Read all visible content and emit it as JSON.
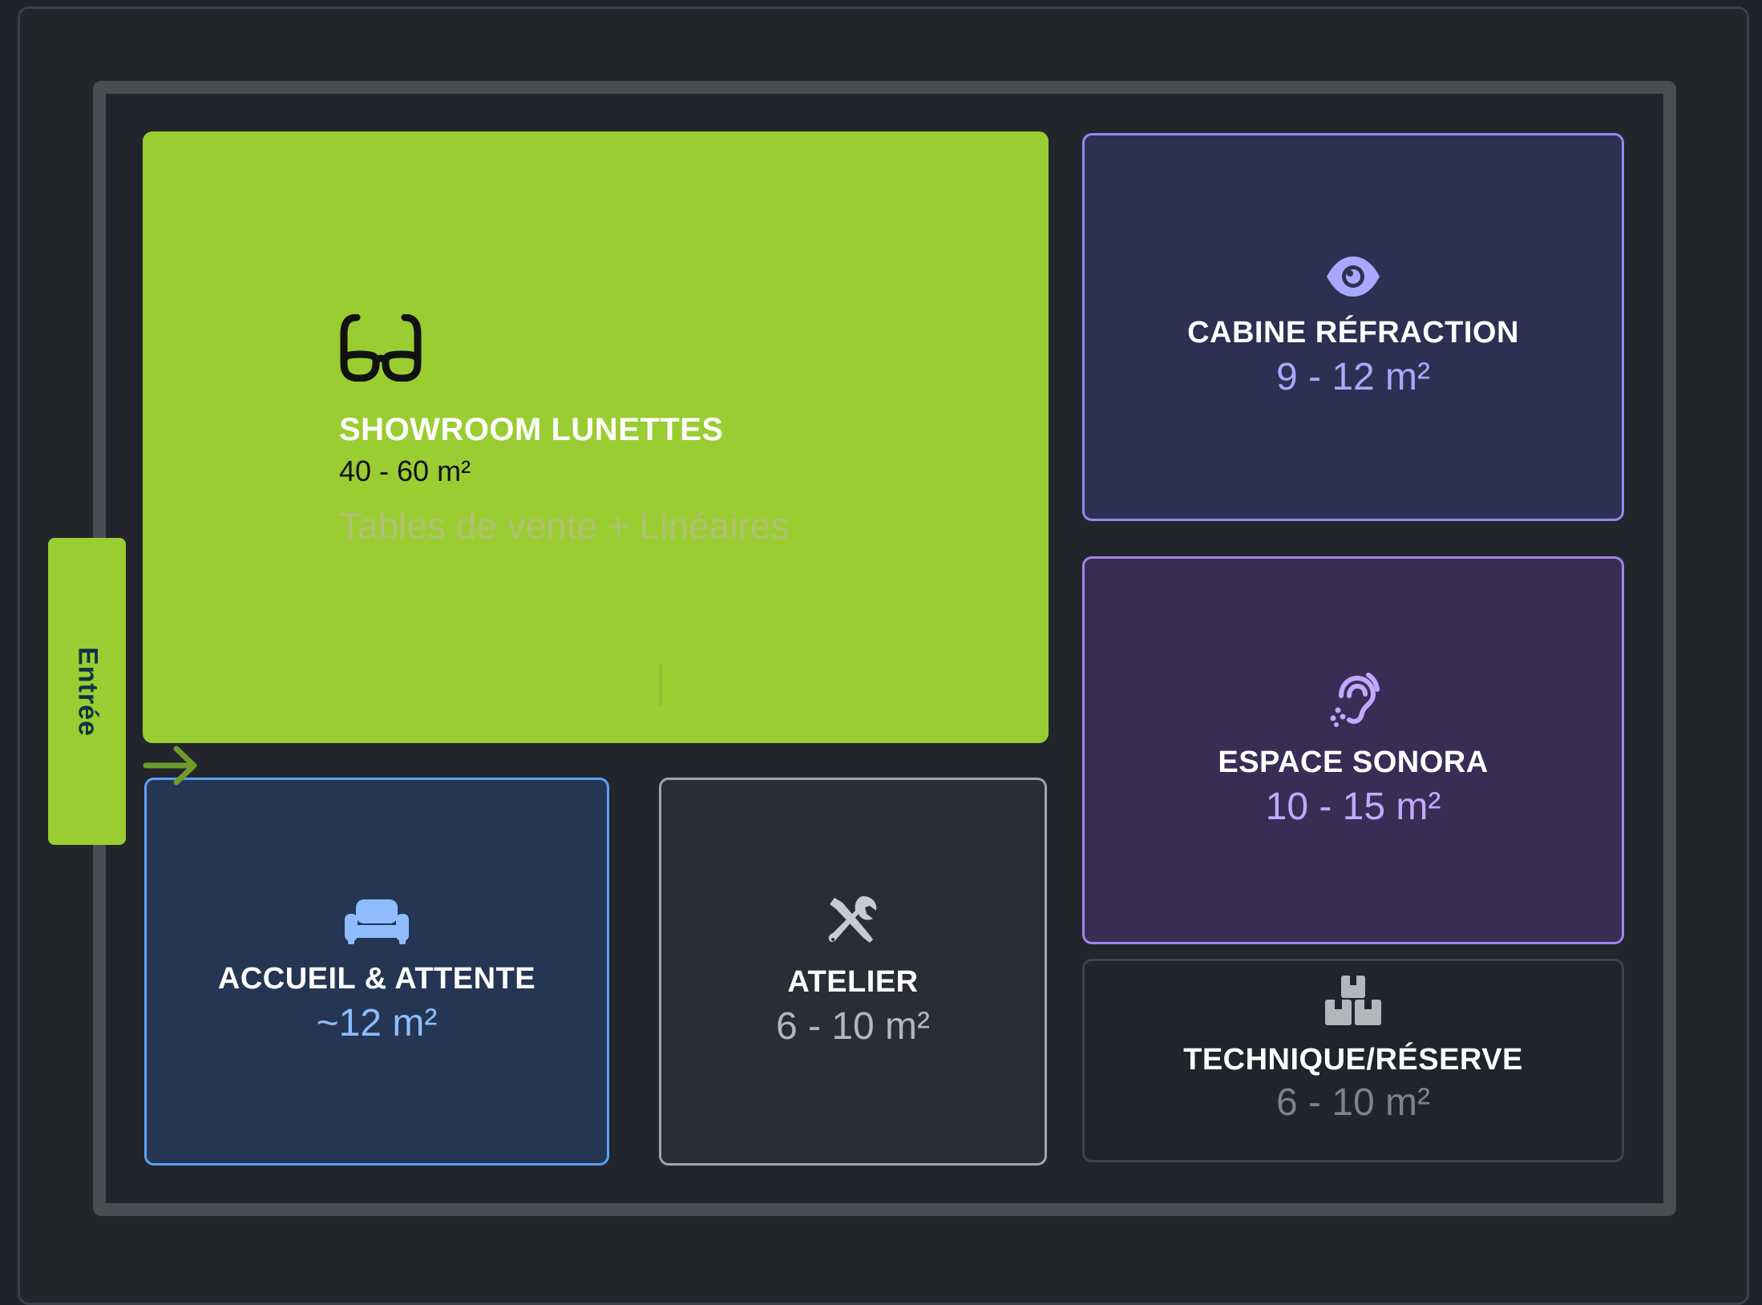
{
  "rooms": {
    "showroom": {
      "title": "SHOWROOM LUNETTES",
      "area": "40 - 60 m²",
      "subtitle": "Tables de vente + Linéaires",
      "icon": "glasses-icon",
      "color": "#9acd32"
    },
    "cabine": {
      "title": "CABINE RÉFRACTION",
      "area": "9 - 12 m²",
      "icon": "eye-icon",
      "color": "#2d3052",
      "accent": "#8d8cf0"
    },
    "sonora": {
      "title": "ESPACE SONORA",
      "area": "10 - 15 m²",
      "icon": "hearing-icon",
      "color": "#382e55",
      "accent": "#a384ec"
    },
    "accueil": {
      "title": "ACCUEIL & ATTENTE",
      "area": "~12 m²",
      "icon": "sofa-icon",
      "color": "#243653",
      "accent": "#5f9ff5"
    },
    "atelier": {
      "title": "ATELIER",
      "area": "6 - 10 m²",
      "icon": "tools-icon",
      "color": "#2a2d35",
      "accent": "#a2a5ac"
    },
    "technique": {
      "title": "TECHNIQUE/RÉSERVE",
      "area": "6 - 10 m²",
      "icon": "boxes-icon",
      "color": "#20242c",
      "accent": "#3e434d"
    }
  },
  "entrance": {
    "label": "Entrée",
    "icon": "arrow-right-icon",
    "color": "#9acd32"
  }
}
